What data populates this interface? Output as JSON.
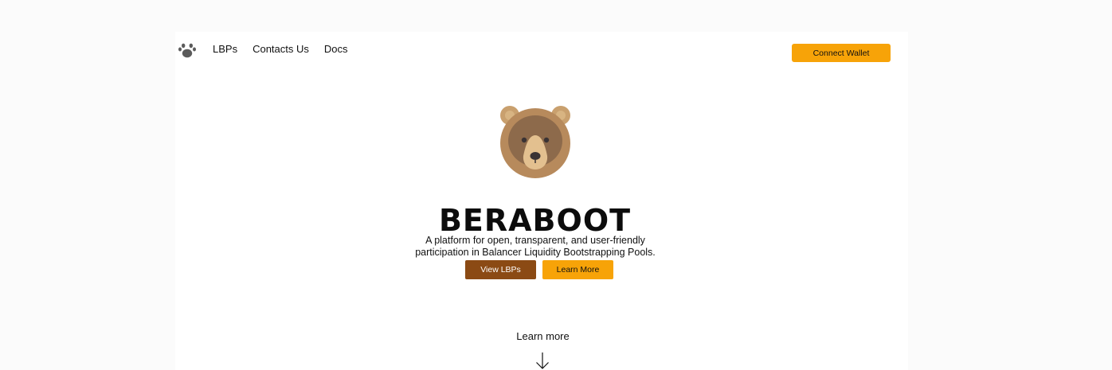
{
  "header": {
    "logo_icon": "paw-icon",
    "nav": [
      {
        "label": "LBPs"
      },
      {
        "label": "Contacts Us"
      },
      {
        "label": "Docs"
      }
    ],
    "connect_label": "Connect Wallet"
  },
  "hero": {
    "mascot_icon": "bear-face-icon",
    "title": "BERABOOT",
    "tagline": "A platform for open, transparent, and user-friendly participation in Balancer Liquidity Bootstrapping Pools.",
    "primary_label": "View LBPs",
    "secondary_label": "Learn More"
  },
  "scroll_hint": {
    "label": "Learn more",
    "icon": "arrow-down-icon"
  },
  "colors": {
    "accent": "#f7a308",
    "brown": "#8b4a14",
    "bear_fur": "#b78a5c",
    "bear_mask": "#8d6a4b"
  }
}
